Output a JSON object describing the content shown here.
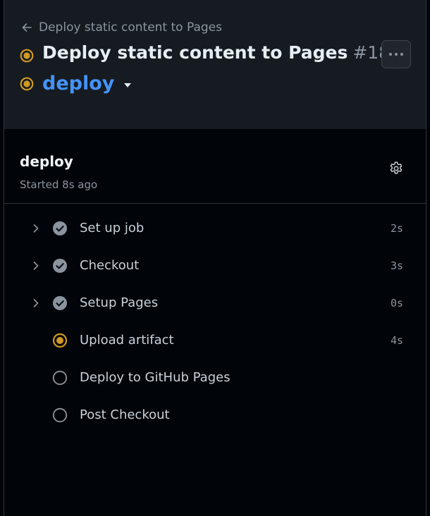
{
  "breadcrumb": {
    "back_label": "Deploy static content to Pages"
  },
  "run": {
    "title": "Deploy static content to Pages",
    "number": "#18",
    "status": "in-progress"
  },
  "job_selector": {
    "label": "deploy"
  },
  "job": {
    "title": "deploy",
    "started": "Started 8s ago"
  },
  "colors": {
    "accent": "#4493f8",
    "in_progress": "#d29922",
    "success": "#8b949e",
    "background": "#010409",
    "header": "#161b22"
  },
  "steps": [
    {
      "name": "Set up job",
      "duration": "2s",
      "status": "success",
      "expandable": true
    },
    {
      "name": "Checkout",
      "duration": "3s",
      "status": "success",
      "expandable": true
    },
    {
      "name": "Setup Pages",
      "duration": "0s",
      "status": "success",
      "expandable": true
    },
    {
      "name": "Upload artifact",
      "duration": "4s",
      "status": "in-progress",
      "expandable": false
    },
    {
      "name": "Deploy to GitHub Pages",
      "duration": "",
      "status": "queued",
      "expandable": false
    },
    {
      "name": "Post Checkout",
      "duration": "",
      "status": "queued",
      "expandable": false
    }
  ]
}
